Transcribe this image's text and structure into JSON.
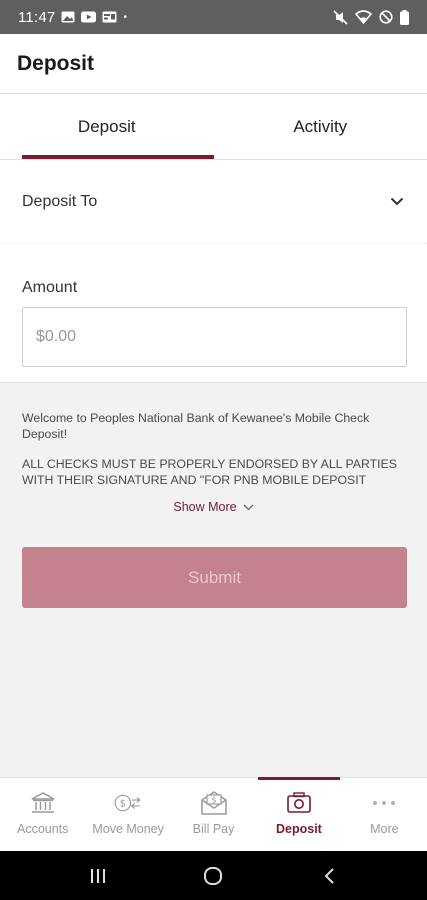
{
  "status_bar": {
    "time": "11:47",
    "dot": "•"
  },
  "header": {
    "title": "Deposit"
  },
  "tabs": [
    {
      "label": "Deposit",
      "active": true
    },
    {
      "label": "Activity",
      "active": false
    }
  ],
  "form": {
    "deposit_to_label": "Deposit To",
    "amount_label": "Amount",
    "amount_placeholder": "$0.00",
    "amount_value": ""
  },
  "info": {
    "welcome": "Welcome to Peoples National Bank of Kewanee's Mobile Check Deposit!",
    "notice": "ALL CHECKS MUST BE PROPERLY ENDORSED BY ALL PARTIES WITH THEIR SIGNATURE AND \"FOR PNB MOBILE DEPOSIT ONLY\"....",
    "show_more": "Show More"
  },
  "submit": {
    "label": "Submit"
  },
  "bottom_nav": [
    {
      "label": "Accounts",
      "icon": "bank-icon",
      "active": false
    },
    {
      "label": "Move Money",
      "icon": "transfer-icon",
      "active": false
    },
    {
      "label": "Bill Pay",
      "icon": "bill-icon",
      "active": false
    },
    {
      "label": "Deposit",
      "icon": "camera-check-icon",
      "active": true
    },
    {
      "label": "More",
      "icon": "more-icon",
      "active": false
    }
  ],
  "colors": {
    "brand": "#7a1a2a",
    "submit_disabled": "#c4818e"
  }
}
